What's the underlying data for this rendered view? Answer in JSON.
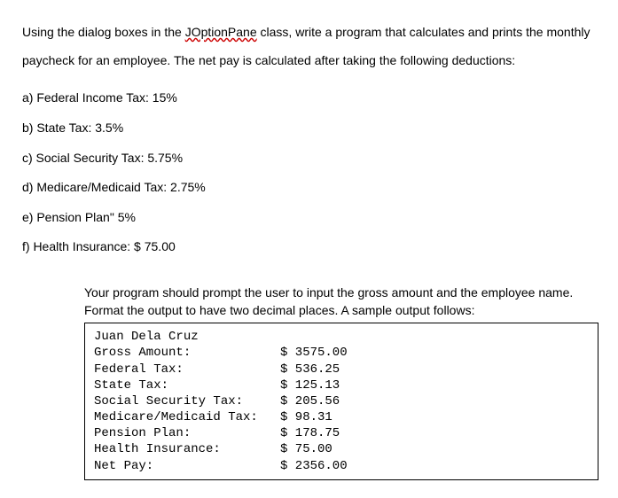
{
  "problem": {
    "intro_part1": "Using the dialog boxes in the ",
    "joption": "JOptionPane",
    "intro_part2": " class, write a program that calculates and prints the monthly paycheck for an employee. The net pay is calculated after taking the following deductions:",
    "items": [
      "a) Federal Income Tax: 15%",
      "b) State Tax: 3.5%",
      "c) Social Security Tax: 5.75%",
      "d) Medicare/Medicaid Tax: 2.75%",
      "e) Pension Plan\" 5%",
      "f) Health Insurance: $ 75.00"
    ]
  },
  "instruction": "Your program should prompt the user to input the gross amount and the employee name. Format the output to have two decimal places. A sample output follows:",
  "output": {
    "name": "Juan Dela Cruz",
    "rows": [
      {
        "label": "Gross Amount:",
        "value": "$ 3575.00"
      },
      {
        "label": "Federal Tax:",
        "value": "$ 536.25"
      },
      {
        "label": "State Tax:",
        "value": "$ 125.13"
      },
      {
        "label": "Social Security Tax:",
        "value": "$ 205.56"
      },
      {
        "label": "Medicare/Medicaid Tax:",
        "value": "$ 98.31"
      },
      {
        "label": "Pension Plan:",
        "value": "$ 178.75"
      },
      {
        "label": "Health Insurance:",
        "value": "$ 75.00"
      },
      {
        "label": "Net Pay:",
        "value": "$ 2356.00"
      }
    ]
  }
}
